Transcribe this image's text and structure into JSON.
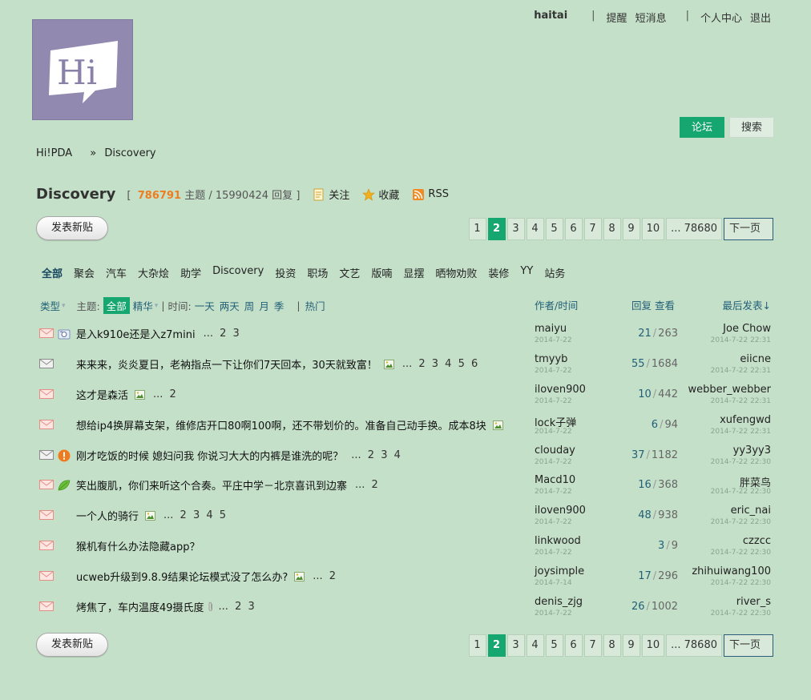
{
  "topbar": {
    "username": "haitai",
    "sep": "|",
    "remind": "提醒",
    "pm": "短消息",
    "center": "个人中心",
    "logout": "退出"
  },
  "logo": {
    "text": "Hi"
  },
  "nav": {
    "forum": "论坛",
    "search": "搜索"
  },
  "breadcrumb": {
    "home": "Hi!PDA",
    "arrow": "»",
    "current": "Discovery"
  },
  "forum": {
    "name": "Discovery",
    "stats_open": "[",
    "threads": "786791",
    "threads_label": "主题 /",
    "replies": "15990424",
    "replies_label": "回复",
    "stats_close": "]",
    "follow": "关注",
    "favorite": "收藏",
    "rss": "RSS"
  },
  "new_post_label": "发表新贴",
  "pager": {
    "pages": [
      "1",
      "2",
      "3",
      "4",
      "5",
      "6",
      "7",
      "8",
      "9",
      "10",
      "... 78680"
    ],
    "current": "2",
    "next": "下一页"
  },
  "categories": [
    "全部",
    "聚会",
    "汽车",
    "大杂烩",
    "助学",
    "Discovery",
    "投资",
    "职场",
    "文艺",
    "版喃",
    "显摆",
    "晒物劝败",
    "装修",
    "YY",
    "站务"
  ],
  "filter": {
    "type": "类型",
    "theme": "主题:",
    "all": "全部",
    "digest": "精华",
    "time": "时间:",
    "time_opts": [
      "一天",
      "两天",
      "周",
      "月",
      "季"
    ],
    "hot": "热门"
  },
  "columns": {
    "author": "作者/时间",
    "replies_views": "回复 查看",
    "last": "最后发表"
  },
  "threads": [
    {
      "title": "是入k910e还是入z7mini",
      "pages": "... 2 3",
      "extra": "photo",
      "pic": false,
      "author": "maiyu",
      "adate": "2014-7-22",
      "replies": "21",
      "views": "263",
      "last": "Joe Chow",
      "ldate": "2014-7-22 22:31"
    },
    {
      "title": "来来来，炎炎夏日，老衲指点一下让你们7天回本，30天就致富！",
      "pages": "... 2 3 4 5 6",
      "extra": "",
      "pic": true,
      "author": "tmyyb",
      "adate": "2014-7-22",
      "replies": "55",
      "views": "1684",
      "last": "eiicne",
      "ldate": "2014-7-22 22:31"
    },
    {
      "title": "这才是森活",
      "pages": "... 2",
      "extra": "",
      "pic": true,
      "author": "iloven900",
      "adate": "2014-7-22",
      "replies": "10",
      "views": "442",
      "last": "webber_webber",
      "ldate": "2014-7-22 22:31"
    },
    {
      "title": "想给ip4换屏幕支架，维修店开口80啊100啊，还不带划价的。准备自己动手换。成本8块",
      "pages": "",
      "extra": "",
      "pic": true,
      "author": "lock子弹",
      "adate": "2014-7-22",
      "replies": "6",
      "views": "94",
      "last": "xufengwd",
      "ldate": "2014-7-22 22:31"
    },
    {
      "title": "刚才吃饭的时候 媳妇问我 你说习大大的内裤是谁洗的呢？",
      "pages": "... 2 3 4",
      "extra": "alert",
      "pic": false,
      "author": "clouday",
      "adate": "2014-7-22",
      "replies": "37",
      "views": "1182",
      "last": "yy3yy3",
      "ldate": "2014-7-22 22:30"
    },
    {
      "title": "笑出腹肌，你们来听这个合奏。平庄中学－北京喜讯到边寨",
      "pages": "... 2",
      "extra": "leaf",
      "pic": false,
      "author": "Macd10",
      "adate": "2014-7-22",
      "replies": "16",
      "views": "368",
      "last": "胖菜鸟",
      "ldate": "2014-7-22 22:30"
    },
    {
      "title": "一个人的骑行",
      "pages": "... 2 3 4 5",
      "extra": "",
      "pic": true,
      "author": "iloven900",
      "adate": "2014-7-22",
      "replies": "48",
      "views": "938",
      "last": "eric_nai",
      "ldate": "2014-7-22 22:30"
    },
    {
      "title": "猴机有什么办法隐藏app？",
      "pages": "",
      "extra": "",
      "pic": false,
      "author": "linkwood",
      "adate": "2014-7-22",
      "replies": "3",
      "views": "9",
      "last": "czzcc",
      "ldate": "2014-7-22 22:30"
    },
    {
      "title": "ucweb升级到9.8.9结果论坛模式没了怎么办?",
      "pages": "... 2",
      "extra": "",
      "pic": true,
      "author": "joysimple",
      "adate": "2014-7-14",
      "replies": "17",
      "views": "296",
      "last": "zhihuiwang100",
      "ldate": "2014-7-22 22:30"
    },
    {
      "title": "烤焦了，车内温度49摄氏度",
      "pages": "... 2 3",
      "extra": "",
      "pic": false,
      "clip": true,
      "author": "denis_zjg",
      "adate": "2014-7-22",
      "replies": "26",
      "views": "1002",
      "last": "river_s",
      "ldate": "2014-7-22 22:30"
    }
  ]
}
